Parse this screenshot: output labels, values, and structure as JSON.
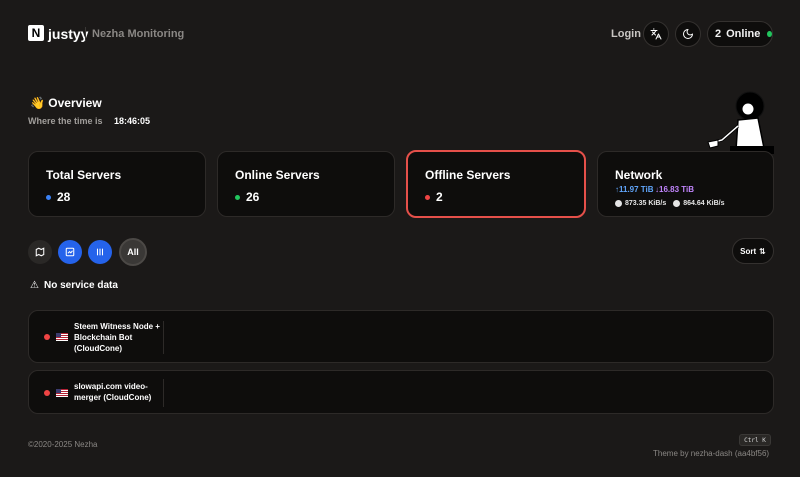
{
  "header": {
    "logo_letter": "N",
    "brand": "justyy",
    "subtitle": "Nezha Monitoring",
    "login_label": "Login",
    "online_count": "2",
    "online_label": "Online"
  },
  "overview": {
    "emoji": "👋",
    "title": "Overview",
    "where_label": "Where the time is",
    "time": "18:46:05"
  },
  "stats": {
    "total": {
      "label": "Total Servers",
      "value": "28"
    },
    "online": {
      "label": "Online Servers",
      "value": "26"
    },
    "offline": {
      "label": "Offline Servers",
      "value": "2"
    },
    "network": {
      "label": "Network",
      "up_total": "↑11.97 TiB",
      "down_total": "↓16.83 TiB",
      "up_speed": "873.35 KiB/s",
      "down_speed": "864.64 KiB/s"
    }
  },
  "filters": {
    "all_label": "All",
    "sort_label": "Sort",
    "sort_icon": "⇅"
  },
  "services": {
    "empty_label": "No service data",
    "warning_icon": "⚠"
  },
  "servers": [
    {
      "name": "Steem Witness Node + Blockchain Bot (CloudCone)",
      "status": "offline"
    },
    {
      "name": "slowapi.com video-merger (CloudCone)",
      "status": "offline"
    }
  ],
  "footer": {
    "copyright": "©2020-2025 Nezha",
    "shortcut": "Ctrl K",
    "theme": "Theme by nezha-dash (aa4bf56)"
  },
  "colors": {
    "background": "#1b1918",
    "card": "#0e0d0c",
    "offline_border": "#e5504a",
    "accent_blue": "#2563eb",
    "online_green": "#22c55e",
    "offline_red": "#ef4444"
  }
}
